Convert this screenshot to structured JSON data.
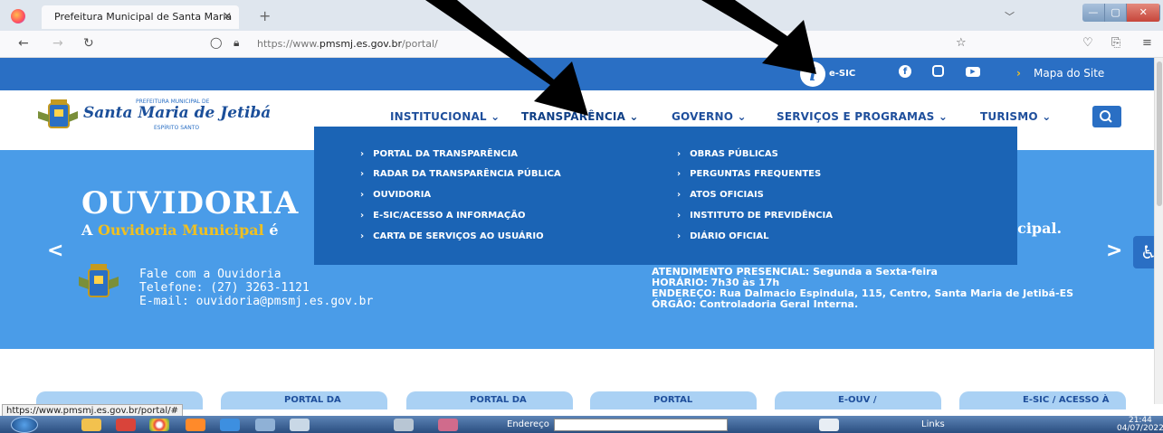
{
  "browser": {
    "tab_title": "Prefeitura Municipal de Santa Maria",
    "tab_close": "✕",
    "new_tab": "+",
    "url_prefix": "https://www.",
    "url_domain": "pmsmj.es.gov.br",
    "url_path": "/portal/",
    "status_url": "https://www.pmsmj.es.gov.br/portal/#"
  },
  "topbar": {
    "esic_label": "e-SIC",
    "sitemap_label": "Mapa do Site"
  },
  "logo": {
    "pre": "PREFEITURA MUNICIPAL DE",
    "name": "Santa Maria de Jetibá",
    "state": "ESPÍRITO SANTO"
  },
  "menu": [
    {
      "label": "INSTITUCIONAL"
    },
    {
      "label": "TRANSPARÊNCIA"
    },
    {
      "label": "GOVERNO"
    },
    {
      "label": "SERVIÇOS E PROGRAMAS"
    },
    {
      "label": "TURISMO"
    }
  ],
  "dropdown": {
    "left": [
      "PORTAL DA TRANSPARÊNCIA",
      "RADAR DA TRANSPARÊNCIA PÚBLICA",
      "OUVIDORIA",
      "E-SIC/ACESSO A INFORMAÇÃO",
      "CARTA DE SERVIÇOS AO USUÁRIO"
    ],
    "right": [
      "OBRAS PÚBLICAS",
      "PERGUNTAS FREQUENTES",
      "ATOS OFICIAIS",
      "INSTITUTO DE PREVIDÊNCIA",
      "DIÁRIO OFICIAL"
    ]
  },
  "hero": {
    "title": "OUVIDORIA",
    "sub_a": "A ",
    "sub_highlight": "Ouvidoria Municipal",
    "sub_b": " é",
    "sub_right": "icipal.",
    "contact": [
      "Fale com a Ouvidoria",
      "Telefone: (27) 3263-1121",
      "E-mail: ouvidoria@pmsmj.es.gov.br"
    ],
    "info": [
      "ATENDIMENTO PRESENCIAL: Segunda a Sexta-feira",
      "HORÁRIO: 7h30 às 17h",
      "ENDEREÇO: Rua Dalmacio Espindula, 115, Centro, Santa Maria de Jetibá-ES",
      "ÓRGÃO: Controladoria Geral Interna."
    ]
  },
  "cards": [
    "PORTAL DA",
    "PORTAL DA",
    "PORTAL",
    "E-OUV /",
    "E-SIC / ACESSO À"
  ],
  "taskbar": {
    "address_label": "Endereço",
    "links_label": "Links",
    "time": "21:44",
    "date": "04/07/2022"
  },
  "colors": {
    "brand_blue": "#2a6fc4",
    "dropdown_blue": "#1b64b5",
    "hero_blue": "#4a9ce8",
    "highlight_yellow": "#f0c020"
  }
}
